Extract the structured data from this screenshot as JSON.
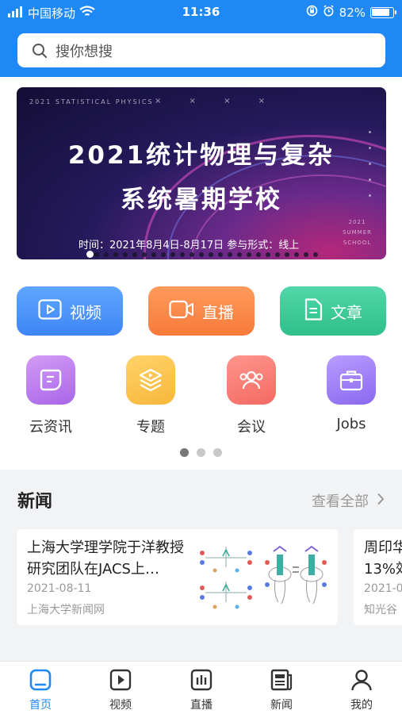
{
  "status": {
    "carrier": "中国移动",
    "time": "11:36",
    "battery": "82%"
  },
  "search": {
    "placeholder": "搜你想搜"
  },
  "banner": {
    "top_small": "2021 STATISTICAL PHYSICS",
    "marks": "× × × ×",
    "title_line1": "2021统计物理与复杂",
    "title_line2": "系统暑期学校",
    "info": "时间：2021年8月4日-8月17日   参与形式：线上",
    "corner_line1": "2021",
    "corner_line2": "SUMMER",
    "corner_line3": "SCHOOL"
  },
  "quick": [
    {
      "label": "视频",
      "icon": "play-icon"
    },
    {
      "label": "直播",
      "icon": "camera-icon"
    },
    {
      "label": "文章",
      "icon": "document-icon"
    }
  ],
  "categories": [
    {
      "label": "云资讯",
      "icon": "chat-icon"
    },
    {
      "label": "专题",
      "icon": "layers-icon"
    },
    {
      "label": "会议",
      "icon": "people-icon"
    },
    {
      "label": "Jobs",
      "icon": "briefcase-icon"
    }
  ],
  "news": {
    "title": "新闻",
    "more": "查看全部",
    "items": [
      {
        "headline": "上海大学理学院于洋教授研究团队在JACS上…",
        "date": "2021-08-11",
        "source": "上海大学新闻网"
      },
      {
        "headline": "周印华\n13%效",
        "date": "2021-0",
        "source": "知光谷"
      }
    ]
  },
  "tabs": [
    {
      "label": "首页",
      "icon": "home-icon"
    },
    {
      "label": "视频",
      "icon": "video-icon"
    },
    {
      "label": "直播",
      "icon": "live-icon"
    },
    {
      "label": "新闻",
      "icon": "newspaper-icon"
    },
    {
      "label": "我的",
      "icon": "profile-icon"
    }
  ],
  "colors": {
    "primary": "#1e88f5",
    "video": "#4a94fb",
    "live": "#f98847",
    "article": "#3bc996"
  }
}
